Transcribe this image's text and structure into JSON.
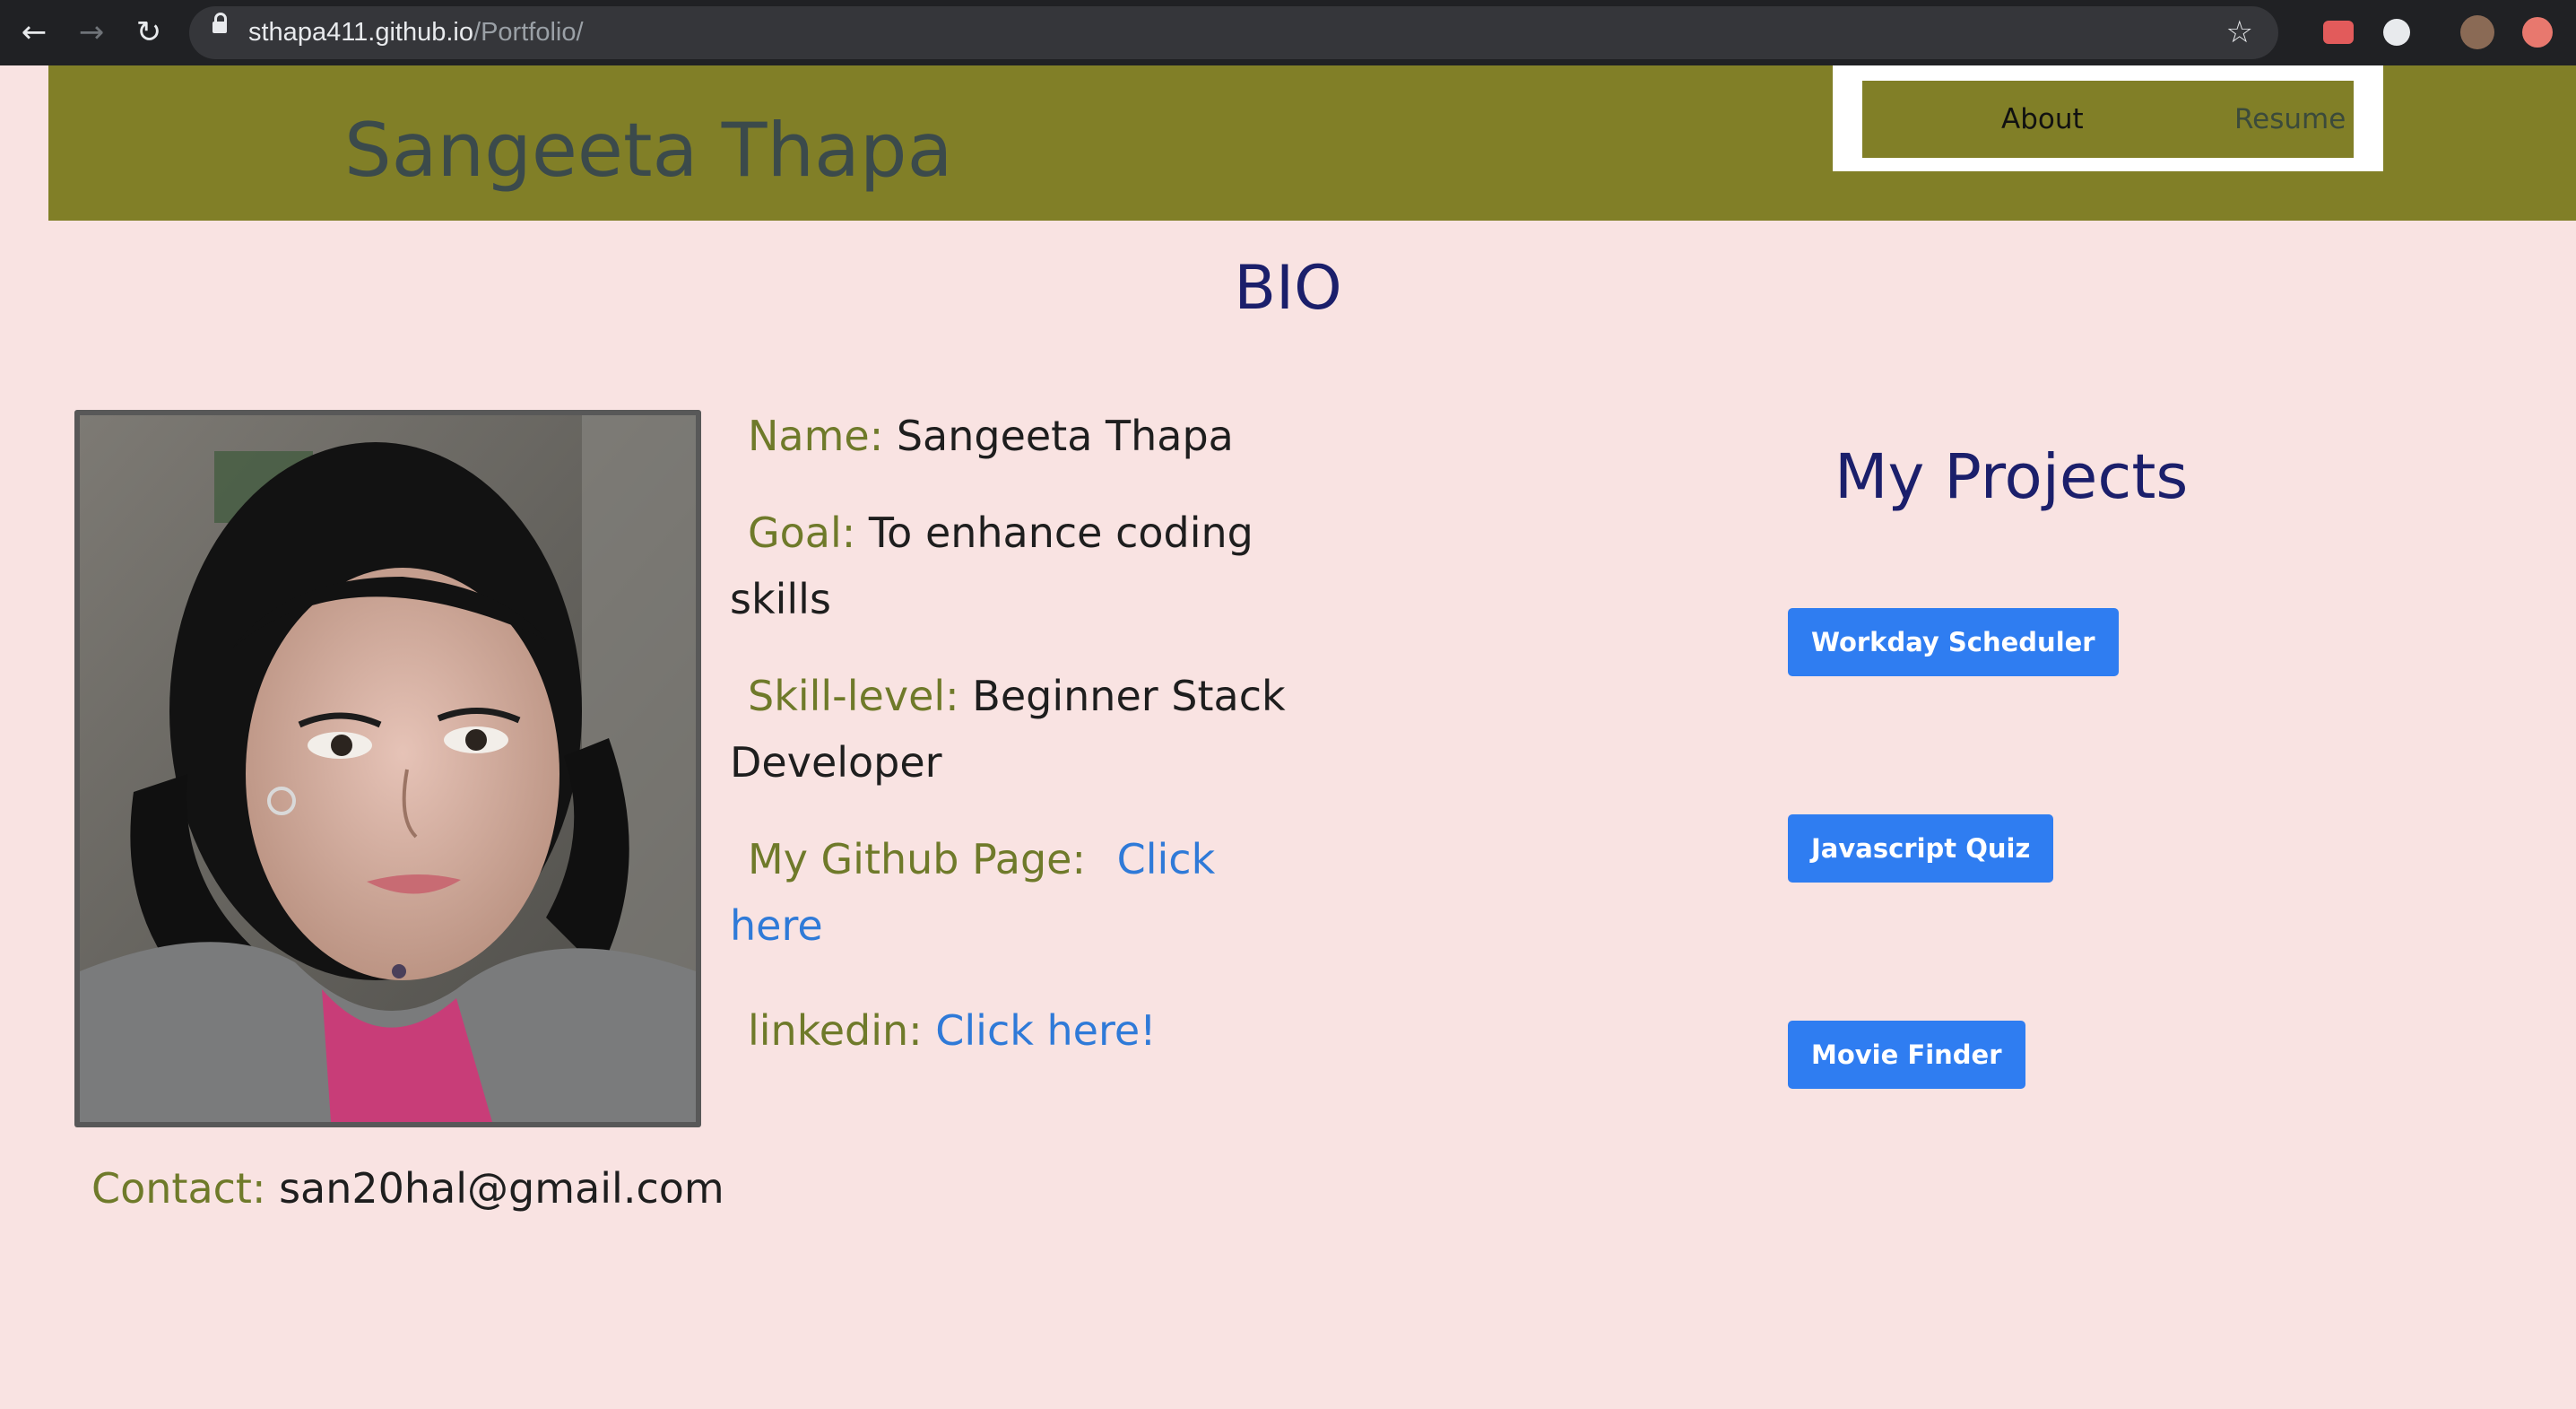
{
  "browser": {
    "url_host": "sthapa411.github.io",
    "url_path": "/Portfolio/"
  },
  "header": {
    "brand": "Sangeeta Thapa",
    "nav": {
      "about": "About",
      "resume": "Resume"
    }
  },
  "bio": {
    "title": "BIO",
    "name_label": "Name:",
    "name_value": "Sangeeta Thapa",
    "goal_label": "Goal:",
    "goal_value_line1": "To enhance coding",
    "goal_value_line2": "skills",
    "skill_label": "Skill-level:",
    "skill_value_line1": "Beginner Stack",
    "skill_value_line2": "Developer",
    "github_label": "My Github Page:",
    "github_link_line1": "Click",
    "github_link_line2": "here",
    "linkedin_label": "linkedin:",
    "linkedin_link": "Click here!",
    "contact_label": "Contact:",
    "contact_value": "san20hal@gmail.com"
  },
  "projects": {
    "title": "My Projects",
    "items": [
      {
        "label": "Workday Scheduler"
      },
      {
        "label": "Javascript Quiz"
      },
      {
        "label": "Movie Finder"
      }
    ]
  },
  "colors": {
    "page_bg": "#f9e3e2",
    "header_bg": "#817f27",
    "label_olive": "#6f7a2a",
    "link_blue": "#2f7ad8",
    "button_blue": "#2f7df1",
    "heading_navy": "#1b1f6b"
  }
}
